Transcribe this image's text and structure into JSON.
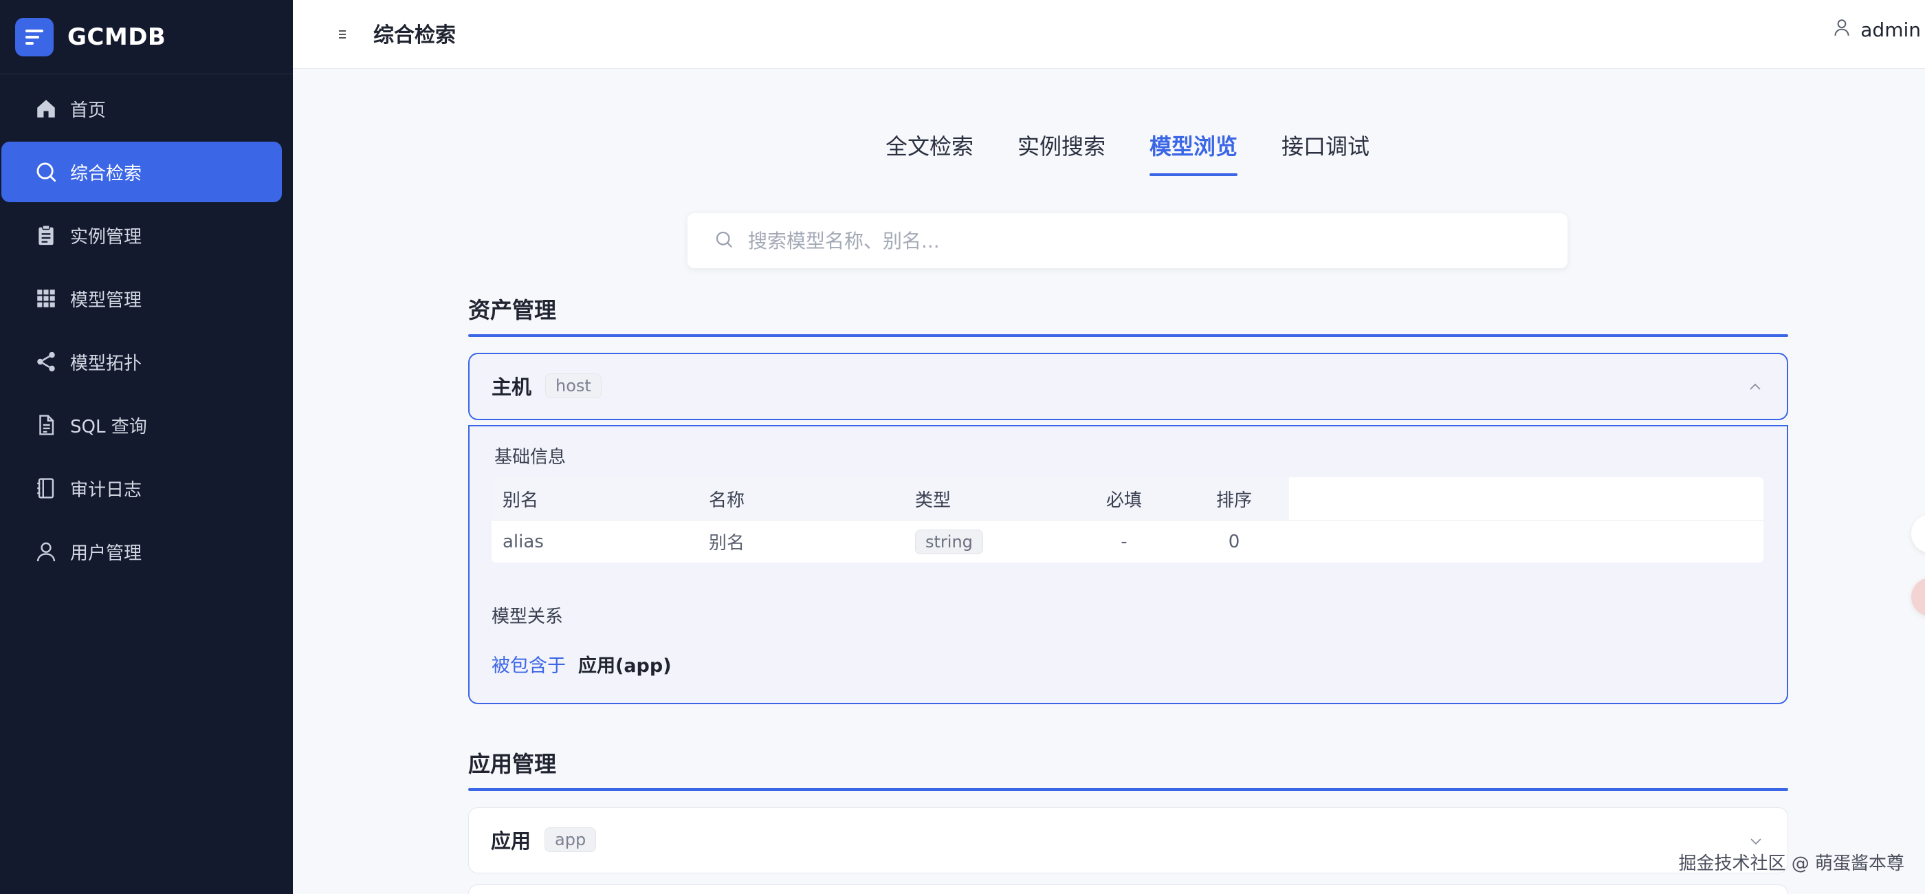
{
  "brand": {
    "name": "GCMDB"
  },
  "sidebar": {
    "items": [
      {
        "label": "首页",
        "icon": "home-icon",
        "active": false
      },
      {
        "label": "综合检索",
        "icon": "search-icon",
        "active": true
      },
      {
        "label": "实例管理",
        "icon": "clipboard-icon",
        "active": false
      },
      {
        "label": "模型管理",
        "icon": "grid-icon",
        "active": false
      },
      {
        "label": "模型拓扑",
        "icon": "share-icon",
        "active": false
      },
      {
        "label": "SQL 查询",
        "icon": "document-icon",
        "active": false
      },
      {
        "label": "审计日志",
        "icon": "notebook-icon",
        "active": false
      },
      {
        "label": "用户管理",
        "icon": "user-icon",
        "active": false
      }
    ]
  },
  "header": {
    "title": "综合检索",
    "user": "admin"
  },
  "tabs": [
    {
      "label": "全文检索",
      "active": false
    },
    {
      "label": "实例搜索",
      "active": false
    },
    {
      "label": "模型浏览",
      "active": true
    },
    {
      "label": "接口调试",
      "active": false
    }
  ],
  "search": {
    "placeholder": "搜索模型名称、别名..."
  },
  "sections": [
    {
      "title": "资产管理",
      "models": [
        {
          "name": "主机",
          "code": "host",
          "expanded": true,
          "attr_group": "基础信息",
          "columns": [
            "别名",
            "名称",
            "类型",
            "必填",
            "排序"
          ],
          "rows": [
            {
              "alias": "alias",
              "name": "别名",
              "type": "string",
              "required": "-",
              "order": "0"
            }
          ],
          "relation_group": "模型关系",
          "relations": [
            {
              "type": "被包含于",
              "target": "应用(app)"
            }
          ]
        }
      ]
    },
    {
      "title": "应用管理",
      "models": [
        {
          "name": "应用",
          "code": "app",
          "expanded": false
        }
      ]
    }
  ],
  "watermark": "掘金技术社区 @ 萌蛋酱本尊",
  "colors": {
    "accent": "#3b66e6",
    "sidebar_bg": "#141a2e",
    "page_bg": "#f7f8fb"
  }
}
